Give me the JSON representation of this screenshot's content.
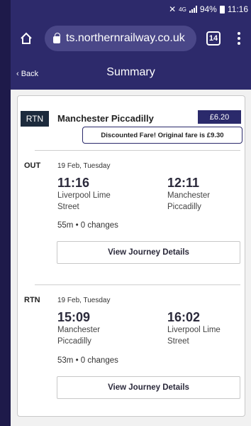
{
  "status_bar": {
    "network": "4G",
    "battery": "94%",
    "time": "11:16"
  },
  "browser": {
    "url": "ts.northernrailway.co.uk",
    "tab_count": "14"
  },
  "header": {
    "back_label": "‹ Back",
    "title": "Summary"
  },
  "fare": {
    "type_tag": "RTN",
    "destination": "Manchester Piccadilly",
    "price": "£6.20",
    "discount_note": "Discounted Fare! Original fare is £9.30"
  },
  "legs": [
    {
      "tag": "OUT",
      "date": "19 Feb, Tuesday",
      "depart_time": "11:16",
      "depart_station_line1": "Liverpool Lime",
      "depart_station_line2": "Street",
      "arrive_time": "12:11",
      "arrive_station_line1": "Manchester",
      "arrive_station_line2": "Piccadilly",
      "summary": "55m • 0 changes",
      "details_button": "View Journey Details"
    },
    {
      "tag": "RTN",
      "date": "19 Feb, Tuesday",
      "depart_time": "15:09",
      "depart_station_line1": "Manchester",
      "depart_station_line2": "Piccadilly",
      "arrive_time": "16:02",
      "arrive_station_line1": "Liverpool Lime",
      "arrive_station_line2": "Street",
      "summary": "53m • 0 changes",
      "details_button": "View Journey Details"
    }
  ]
}
